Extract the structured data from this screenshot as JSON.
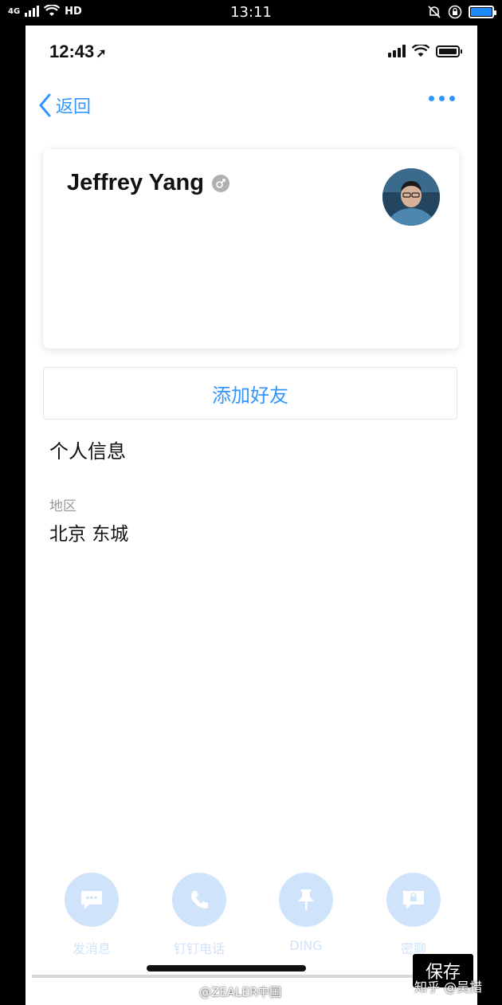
{
  "outer_status": {
    "network": "4G",
    "hd": "HD",
    "time": "13:11"
  },
  "inner_status": {
    "time": "12:43",
    "location_glyph": "➚"
  },
  "nav": {
    "back_label": "返回"
  },
  "profile": {
    "name": "Jeffrey Yang",
    "gender_glyph": "♂"
  },
  "add_friend_label": "添加好友",
  "personal_info": {
    "title": "个人信息",
    "region_label": "地区",
    "region_value": "北京 东城"
  },
  "actions": [
    {
      "label": "发消息",
      "icon": "message-icon"
    },
    {
      "label": "钉钉电话",
      "icon": "phone-icon"
    },
    {
      "label": "DING",
      "icon": "pin-icon"
    },
    {
      "label": "密聊",
      "icon": "secret-chat-icon"
    }
  ],
  "overlay": {
    "save_label": "保存",
    "weibo_watermark": "@ZEALER中国",
    "zhihu_watermark": "知乎 @吴措"
  },
  "colors": {
    "accent": "#3296fa",
    "action_circle": "#cfe4fb"
  }
}
